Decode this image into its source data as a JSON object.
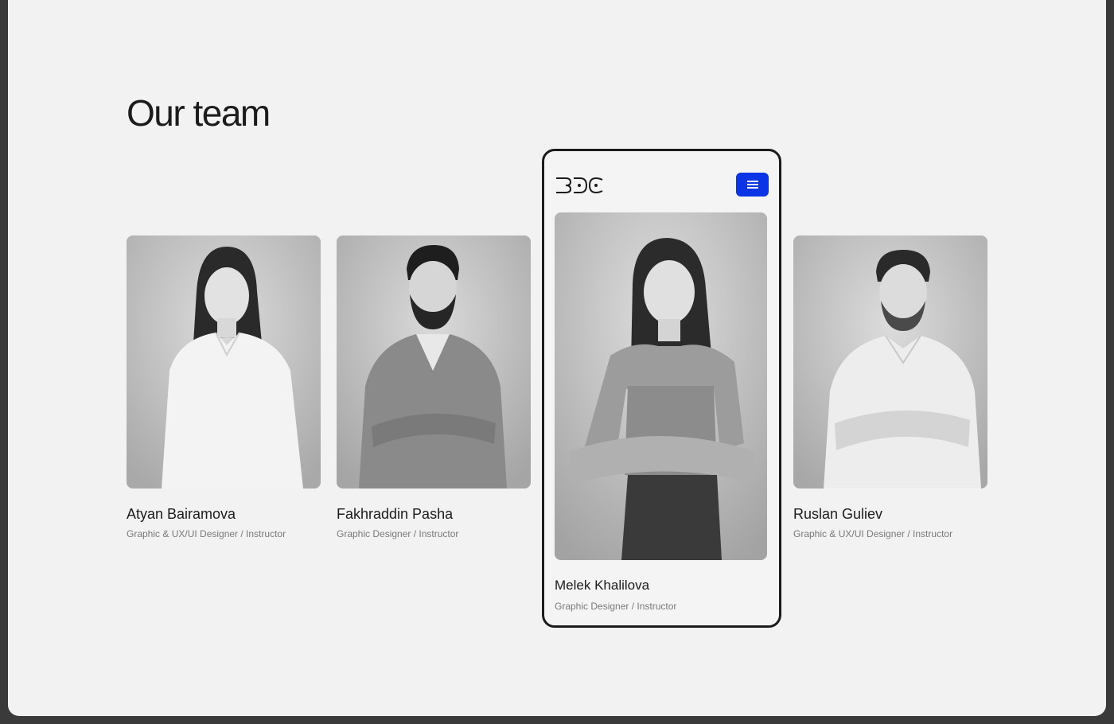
{
  "section": {
    "title": "Our team"
  },
  "team": [
    {
      "name": "Atyan Bairamova",
      "role": "Graphic & UX/UI Designer / Instructor"
    },
    {
      "name": "Fakhraddin Pasha",
      "role": "Graphic Designer / Instructor"
    },
    {
      "name": "Melek Khalilova",
      "role": "Graphic Designer / Instructor"
    },
    {
      "name": "Ruslan Guliev",
      "role": "Graphic & UX/UI Designer / Instructor"
    }
  ],
  "mobile_preview": {
    "logo": "BDC",
    "menu_icon": "hamburger-menu-icon"
  },
  "colors": {
    "accent": "#0a34e6",
    "background": "#f2f2f2",
    "text": "#1c1c1c",
    "muted_text": "#7a7a7a"
  }
}
